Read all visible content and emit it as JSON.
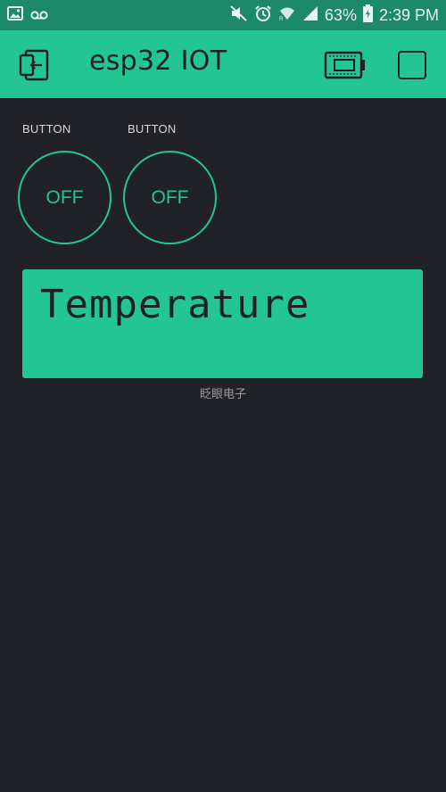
{
  "status_bar": {
    "battery_percent": "63%",
    "time": "2:39 PM"
  },
  "app_bar": {
    "title": "esp32 IOT"
  },
  "widgets": {
    "buttons": [
      {
        "label": "BUTTON",
        "state": "OFF"
      },
      {
        "label": "BUTTON",
        "state": "OFF"
      }
    ],
    "lcd": {
      "text": "Temperature",
      "label": "眨眼电子"
    }
  },
  "colors": {
    "accent": "#23c690",
    "status_bar": "#1c8a68",
    "background": "#212227"
  }
}
